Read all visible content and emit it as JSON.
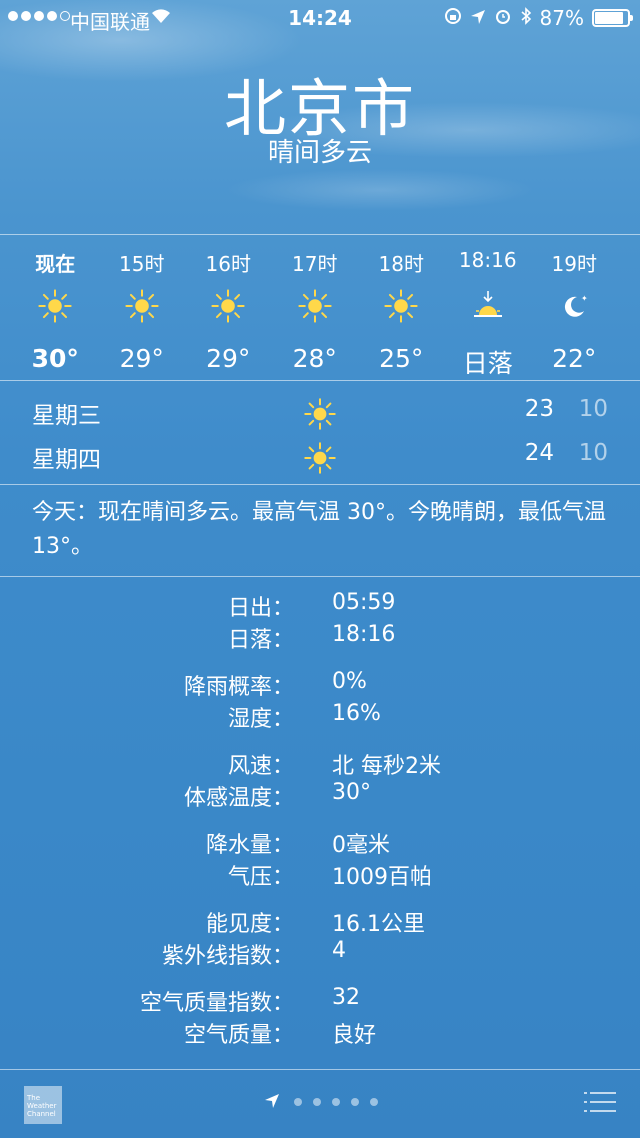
{
  "status_bar": {
    "carrier": "中国联通",
    "time": "14:24",
    "battery": "87%",
    "battery_level": 0.87
  },
  "header": {
    "city": "北京市",
    "condition": "晴间多云"
  },
  "hourly": [
    {
      "time": "现在",
      "icon": "sun-icon",
      "temp": "30°"
    },
    {
      "time": "15时",
      "icon": "sun-icon",
      "temp": "29°"
    },
    {
      "time": "16时",
      "icon": "sun-icon",
      "temp": "29°"
    },
    {
      "time": "17时",
      "icon": "sun-icon",
      "temp": "28°"
    },
    {
      "time": "18时",
      "icon": "sun-icon",
      "temp": "25°"
    },
    {
      "time": "18:16",
      "icon": "sunset-icon",
      "temp": "日落"
    },
    {
      "time": "19时",
      "icon": "moon-icon",
      "temp": "22°"
    }
  ],
  "daily": [
    {
      "day": "星期三",
      "icon": "sun-icon",
      "high": "23",
      "low": "10"
    },
    {
      "day": "星期四",
      "icon": "sun-icon",
      "high": "24",
      "low": "10"
    }
  ],
  "summary": "今天：现在晴间多云。最高气温 30°。今晚晴朗，最低气温 13°。",
  "details": [
    [
      {
        "k": "日出：",
        "v": "05:59"
      },
      {
        "k": "日落：",
        "v": "18:16"
      }
    ],
    [
      {
        "k": "降雨概率：",
        "v": "0%"
      },
      {
        "k": "湿度：",
        "v": "16%"
      }
    ],
    [
      {
        "k": "风速：",
        "v": "北 每秒2米"
      },
      {
        "k": "体感温度：",
        "v": "30°"
      }
    ],
    [
      {
        "k": "降水量：",
        "v": "0毫米"
      },
      {
        "k": "气压：",
        "v": "1009百帕"
      }
    ],
    [
      {
        "k": "能见度：",
        "v": "16.1公里"
      },
      {
        "k": "紫外线指数：",
        "v": "4"
      }
    ],
    [
      {
        "k": "空气质量指数：",
        "v": "32"
      },
      {
        "k": "空气质量：",
        "v": "良好"
      }
    ]
  ],
  "footer": {
    "logo_text": "The Weather Channel",
    "page_dots": 5
  },
  "colors": {
    "sun": "#ffd84a",
    "low_temp": "#a9cfee"
  }
}
